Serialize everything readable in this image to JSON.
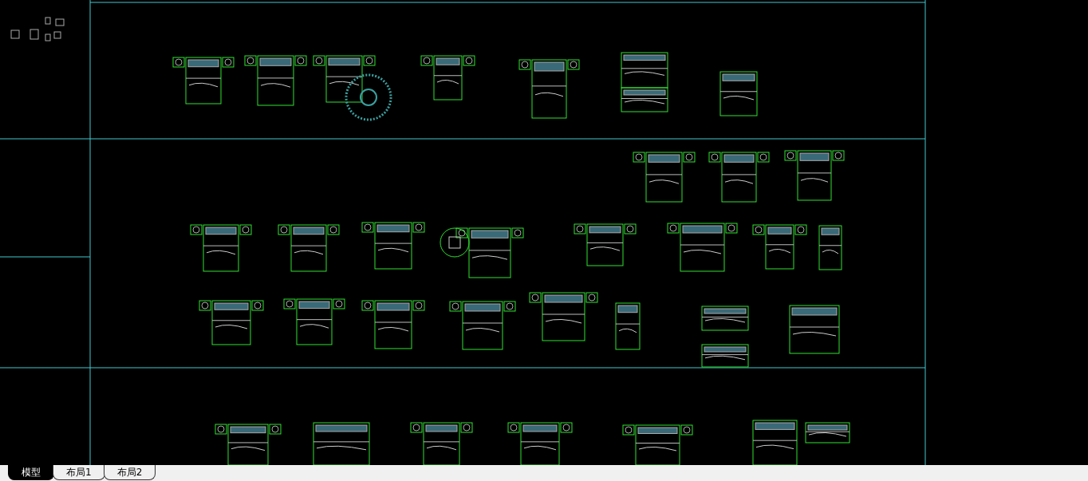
{
  "layout_tabs": [
    {
      "label": "模型",
      "selected": true
    },
    {
      "label": "布局1",
      "selected": false
    },
    {
      "label": "布局2",
      "selected": false
    }
  ]
}
